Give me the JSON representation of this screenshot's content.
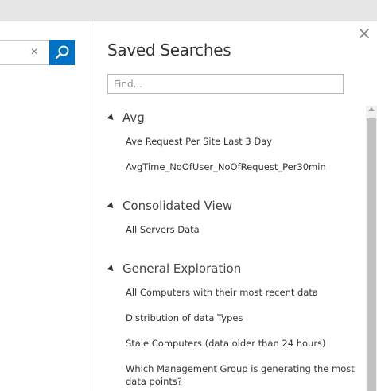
{
  "search": {
    "clear_label": "×",
    "icon": "search-icon"
  },
  "panel": {
    "title": "Saved Searches",
    "close_label": "×",
    "find_placeholder": "Find..."
  },
  "groups": [
    {
      "label": "Avg",
      "items": [
        "Ave Request Per Site Last 3 Day",
        "AvgTime_NoOfUser_NoOfRequest_Per30min"
      ]
    },
    {
      "label": "Consolidated View",
      "items": [
        "All Servers Data"
      ]
    },
    {
      "label": "General Exploration",
      "items": [
        "All Computers with their most recent data",
        "Distribution of data Types",
        "Stale Computers (data older than 24 hours)",
        "Which Management Group is generating the most data points?"
      ]
    }
  ],
  "colors": {
    "accent": "#0072c6",
    "topbar": "#e6e6e6"
  }
}
